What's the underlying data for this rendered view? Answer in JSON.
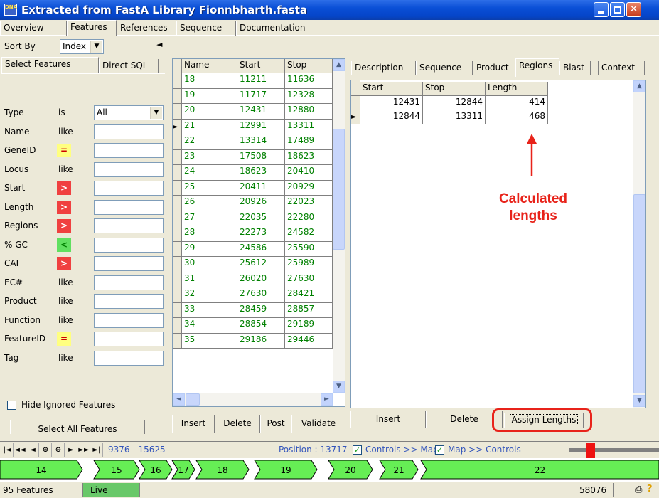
{
  "window": {
    "title": "Extracted from FastA Library Fionnbharth.fasta",
    "app_icon": "DNA"
  },
  "top_tabs": [
    "Overview",
    "Features",
    "References",
    "Sequence",
    "Documentation"
  ],
  "left": {
    "sort_by_label": "Sort By",
    "sort_by_value": "Index",
    "collapse_glyph": "◄",
    "tabs": [
      "Select Features",
      "Direct SQL"
    ],
    "filters": [
      {
        "name": "Type",
        "op": "is",
        "op_style": "text",
        "value": "All"
      },
      {
        "name": "Name",
        "op": "like",
        "op_style": "text"
      },
      {
        "name": "GeneID",
        "op": "=",
        "op_style": "yellow"
      },
      {
        "name": "Locus",
        "op": "like",
        "op_style": "text"
      },
      {
        "name": "Start",
        "op": ">",
        "op_style": "red"
      },
      {
        "name": "Length",
        "op": ">",
        "op_style": "red"
      },
      {
        "name": "Regions",
        "op": ">",
        "op_style": "red"
      },
      {
        "name": "% GC",
        "op": "<",
        "op_style": "green"
      },
      {
        "name": "CAI",
        "op": ">",
        "op_style": "red"
      },
      {
        "name": "EC#",
        "op": "like",
        "op_style": "text"
      },
      {
        "name": "Product",
        "op": "like",
        "op_style": "text"
      },
      {
        "name": "Function",
        "op": "like",
        "op_style": "text"
      },
      {
        "name": "FeatureID",
        "op": "=",
        "op_style": "yellow"
      },
      {
        "name": "Tag",
        "op": "like",
        "op_style": "text"
      }
    ],
    "hide_ignored": "Hide Ignored Features",
    "select_all": "Select All Features"
  },
  "feature_grid": {
    "columns": [
      "Name",
      "Start",
      "Stop"
    ],
    "current_row_index": 3,
    "rows": [
      [
        "18",
        "11211",
        "11636"
      ],
      [
        "19",
        "11717",
        "12328"
      ],
      [
        "20",
        "12431",
        "12880"
      ],
      [
        "21",
        "12991",
        "13311"
      ],
      [
        "22",
        "13314",
        "17489"
      ],
      [
        "23",
        "17508",
        "18623"
      ],
      [
        "24",
        "18623",
        "20410"
      ],
      [
        "25",
        "20411",
        "20929"
      ],
      [
        "26",
        "20926",
        "22023"
      ],
      [
        "27",
        "22035",
        "22280"
      ],
      [
        "28",
        "22273",
        "24582"
      ],
      [
        "29",
        "24586",
        "25590"
      ],
      [
        "30",
        "25612",
        "25989"
      ],
      [
        "31",
        "26020",
        "27630"
      ],
      [
        "32",
        "27630",
        "28421"
      ],
      [
        "33",
        "28459",
        "28857"
      ],
      [
        "34",
        "28854",
        "29189"
      ],
      [
        "35",
        "29186",
        "29446"
      ]
    ],
    "buttons": [
      "Insert",
      "Delete",
      "Post",
      "Validate"
    ]
  },
  "right": {
    "tabs": [
      "Description",
      "Sequence",
      "Product",
      "Regions",
      "Blast",
      "Context"
    ],
    "active_tab": "Regions",
    "columns": [
      "Start",
      "Stop",
      "Length"
    ],
    "rows": [
      [
        "12431",
        "12844",
        "414"
      ],
      [
        "12844",
        "13311",
        "468"
      ]
    ],
    "current_row_index": 1,
    "buttons": [
      "Insert",
      "Delete",
      "Assign Lengths"
    ],
    "annotation": "Calculated\nlengths",
    "annotation_color": "#e8231a"
  },
  "navbar": {
    "range": "9376 - 15625",
    "position": "Position : 13717",
    "controls_to_map": "Controls >> Map",
    "map_to_controls": "Map >> Controls"
  },
  "feature_strip": [
    "14",
    "15",
    "16",
    "17",
    "18",
    "19",
    "20",
    "21",
    "22"
  ],
  "feature_color": "#66ee55",
  "status": {
    "features": "95 Features",
    "mode": "Live",
    "length": "58076"
  }
}
